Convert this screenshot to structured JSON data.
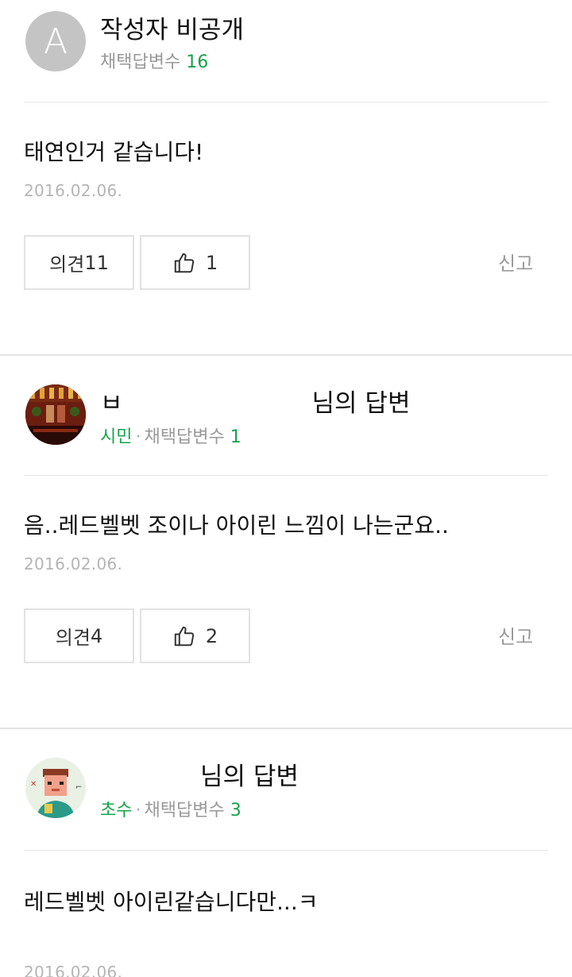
{
  "answers": [
    {
      "author": "작성자 비공개",
      "avatar_letter": "A",
      "grade": "",
      "accepted_label": "채택답변수",
      "accepted_count": "16",
      "content": "태연인거 같습니다!",
      "date": "2016.02.06.",
      "opinion_label": "의견",
      "opinion_count": "11",
      "like_count": "1",
      "report_label": "신고"
    },
    {
      "author_prefix": "ㅂ",
      "author_suffix": "님의 답변",
      "grade": "시민",
      "accepted_label": "채택답변수",
      "accepted_count": "1",
      "content": "음..레드벨벳 조이나 아이린 느낌이 나는군요..",
      "date": "2016.02.06.",
      "opinion_label": "의견",
      "opinion_count": "4",
      "like_count": "2",
      "report_label": "신고"
    },
    {
      "author_prefix": "",
      "author_suffix": "님의 답변",
      "grade": "초수",
      "accepted_label": "채택답변수",
      "accepted_count": "3",
      "content": "레드벨벳 아이린같습니다만...ㅋ",
      "date": "2016.02.06."
    }
  ],
  "colors": {
    "accent_green": "#17a34a",
    "border": "#e2e2e2",
    "muted": "#999999"
  },
  "icons": {
    "like": "thumbs-up-icon"
  }
}
